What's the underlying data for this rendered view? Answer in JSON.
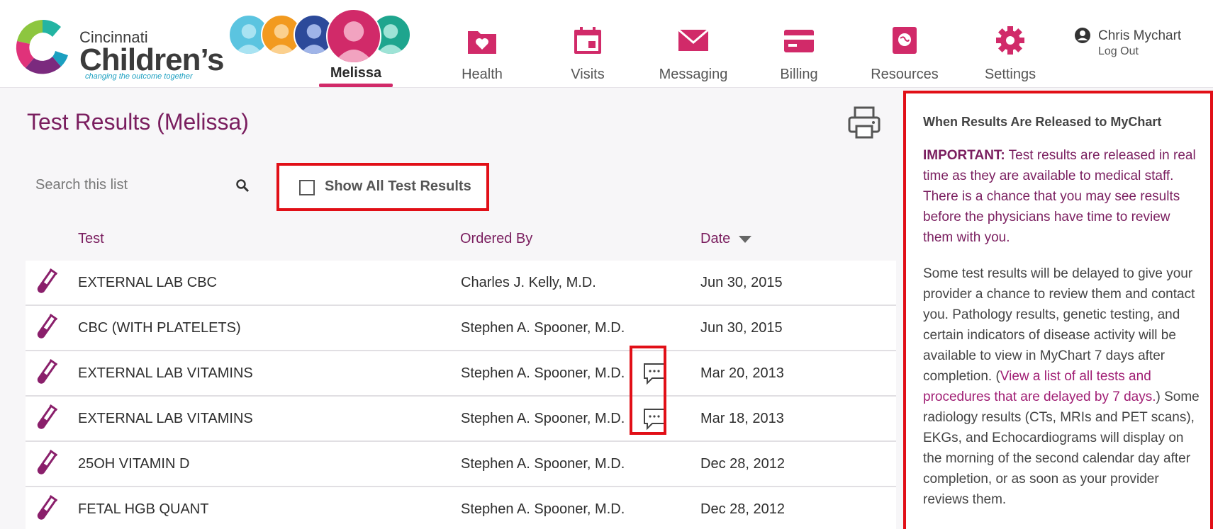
{
  "header": {
    "logo": {
      "line1": "Cincinnati",
      "line2": "Children’s",
      "tagline": "changing the outcome together"
    },
    "active_patient": "Melissa",
    "nav": [
      {
        "label": "Health",
        "icon": "folder-heart-icon"
      },
      {
        "label": "Visits",
        "icon": "calendar-icon"
      },
      {
        "label": "Messaging",
        "icon": "envelope-icon"
      },
      {
        "label": "Billing",
        "icon": "credit-card-icon"
      },
      {
        "label": "Resources",
        "icon": "book-globe-icon"
      },
      {
        "label": "Settings",
        "icon": "gear-icon"
      }
    ],
    "user": {
      "name": "Chris Mychart",
      "logout": "Log Out"
    }
  },
  "main": {
    "title": "Test Results (Melissa)",
    "search": {
      "placeholder": "Search this list",
      "value": ""
    },
    "show_all": {
      "label": "Show All Test Results",
      "checked": false
    },
    "columns": {
      "test": "Test",
      "ordered_by": "Ordered By",
      "date": "Date"
    },
    "rows": [
      {
        "test": "EXTERNAL LAB CBC",
        "ordered_by": "Charles J. Kelly, M.D.",
        "date": "Jun 30, 2015",
        "comment": false
      },
      {
        "test": "CBC (WITH PLATELETS)",
        "ordered_by": "Stephen A. Spooner, M.D.",
        "date": "Jun 30, 2015",
        "comment": false
      },
      {
        "test": "EXTERNAL LAB VITAMINS",
        "ordered_by": "Stephen A. Spooner, M.D.",
        "date": "Mar 20, 2013",
        "comment": true
      },
      {
        "test": "EXTERNAL LAB VITAMINS",
        "ordered_by": "Stephen A. Spooner, M.D.",
        "date": "Mar 18, 2013",
        "comment": true
      },
      {
        "test": "25OH VITAMIN D",
        "ordered_by": "Stephen A. Spooner, M.D.",
        "date": "Dec 28, 2012",
        "comment": false
      },
      {
        "test": "FETAL HGB QUANT",
        "ordered_by": "Stephen A. Spooner, M.D.",
        "date": "Dec 28, 2012",
        "comment": false
      }
    ]
  },
  "panel": {
    "title": "When Results Are Released to MyChart",
    "important_label": "IMPORTANT:",
    "important_text": " Test results are released in real time as they are available to medical staff. There is a chance that you may see results before the physicians have time to review them with you.",
    "p2_before": "Some test results will be delayed to give your provider a chance to review them and contact you. Pathology results, genetic testing, and certain indicators of disease activity will be available to view in MyChart 7 days after completion. (",
    "p2_link": "View a list of all tests and procedures that are delayed by 7 days.",
    "p2_after": ") Some radiology results (CTs, MRIs and PET scans), EKGs, and Echocardiograms will display on the morning of the second calendar day after completion, or as soon as your provider reviews them."
  },
  "colors": {
    "accent": "#7a1e5f",
    "brand_pink": "#d12a69",
    "highlight_red": "#e10f17"
  }
}
